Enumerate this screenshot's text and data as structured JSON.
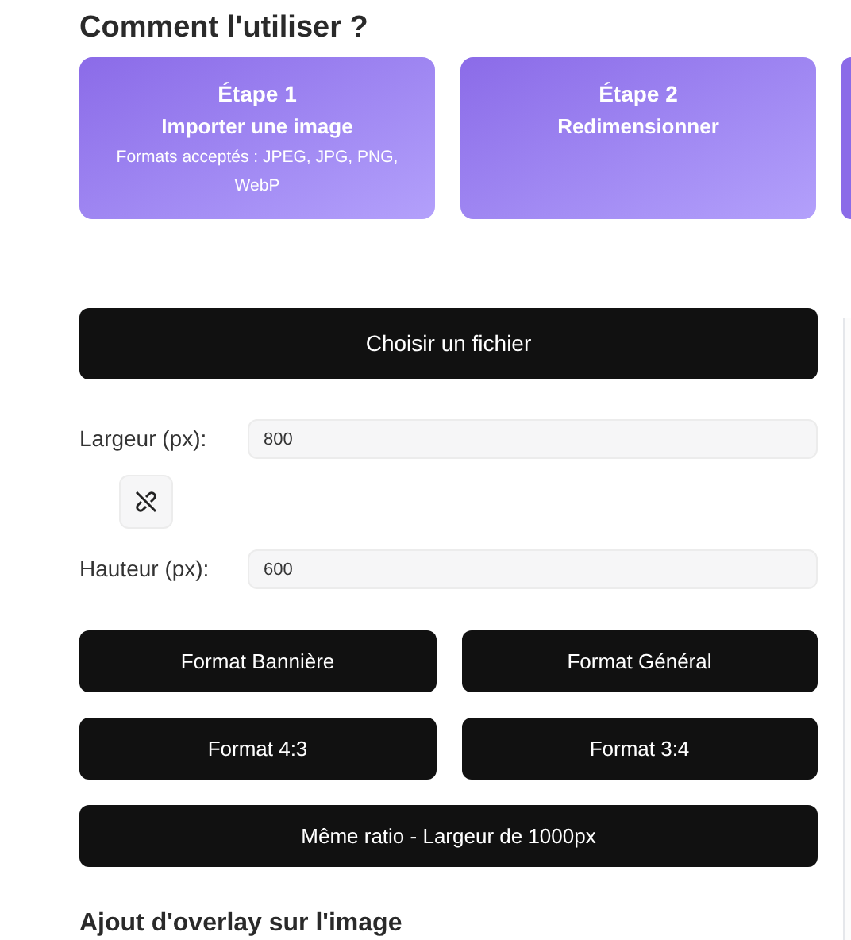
{
  "heading": "Comment l'utiliser ?",
  "steps": [
    {
      "title": "Étape 1",
      "subtitle": "Importer une image",
      "note": "Formats acceptés : JPEG, JPG, PNG, WebP"
    },
    {
      "title": "Étape 2",
      "subtitle": "Redimensionner"
    },
    {
      "kind": "cut"
    }
  ],
  "file_button": "Choisir un fichier",
  "width": {
    "label": "Largeur (px):",
    "value": "800"
  },
  "ratio_lock": {
    "locked": false
  },
  "height": {
    "label": "Hauteur (px):",
    "value": "600"
  },
  "presets": [
    "Format Bannière",
    "Format Général",
    "Format 4:3",
    "Format 3:4"
  ],
  "ratio_button": "Même ratio - Largeur de 1000px",
  "overlay_heading": "Ajout d'overlay sur l'image"
}
